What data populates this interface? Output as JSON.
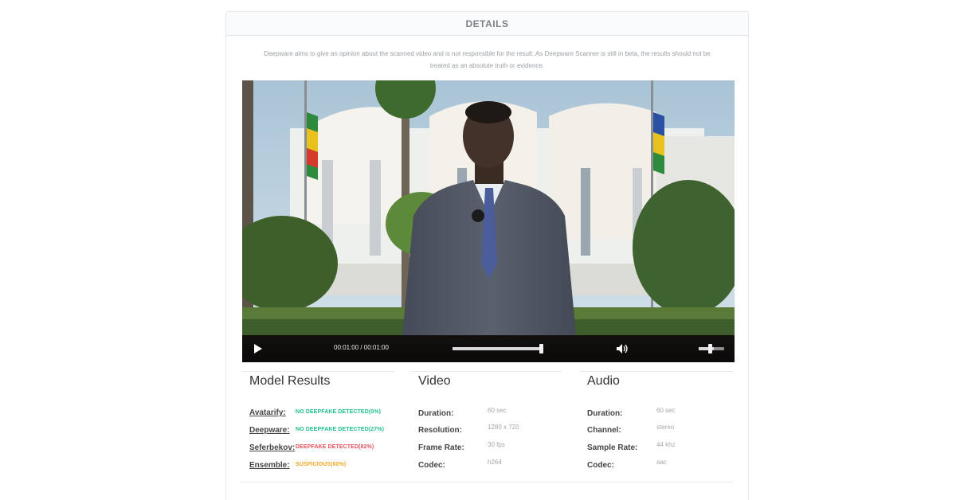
{
  "card": {
    "header": "DETAILS",
    "disclaimer_line1": "Deepware aims to give an opinion about the scanned video and is not responsible for the result. As Deepware Scanner is still in beta, the results should not be",
    "disclaimer_line2": "treated as an absolute truth or evidence."
  },
  "player": {
    "time": "00:01:00 / 00:01:00",
    "progress_fraction": 1.0,
    "volume_fraction": 0.6,
    "icons": {
      "play": "play-icon",
      "volume": "volume-icon"
    }
  },
  "model_results": {
    "title": "Model Results",
    "items": [
      {
        "name": "Avatarify:",
        "result": "NO DEEPFAKE DETECTED(0%)",
        "status": "clean",
        "color": "#1fbf8f"
      },
      {
        "name": "Deepware:",
        "result": "NO DEEPFAKE DETECTED(27%)",
        "status": "clean",
        "color": "#1fbf8f"
      },
      {
        "name": "Seferbekov:",
        "result": "DEEPFAKE DETECTED(82%)",
        "status": "fake",
        "color": "#e8505b"
      },
      {
        "name": "Ensemble:",
        "result": "SUSPICIOUS(60%)",
        "status": "suspicious",
        "color": "#f5a623"
      }
    ]
  },
  "video_info": {
    "title": "Video",
    "rows": [
      {
        "label": "Duration:",
        "value": "60 sec"
      },
      {
        "label": "Resolution:",
        "value": "1280 x 720"
      },
      {
        "label": "Frame Rate:",
        "value": "30 fps"
      },
      {
        "label": "Codec:",
        "value": "h264"
      }
    ]
  },
  "audio_info": {
    "title": "Audio",
    "rows": [
      {
        "label": "Duration:",
        "value": "60 sec"
      },
      {
        "label": "Channel:",
        "value": "stereo"
      },
      {
        "label": "Sample Rate:",
        "value": "44 khz"
      },
      {
        "label": "Codec:",
        "value": "aac"
      }
    ]
  }
}
